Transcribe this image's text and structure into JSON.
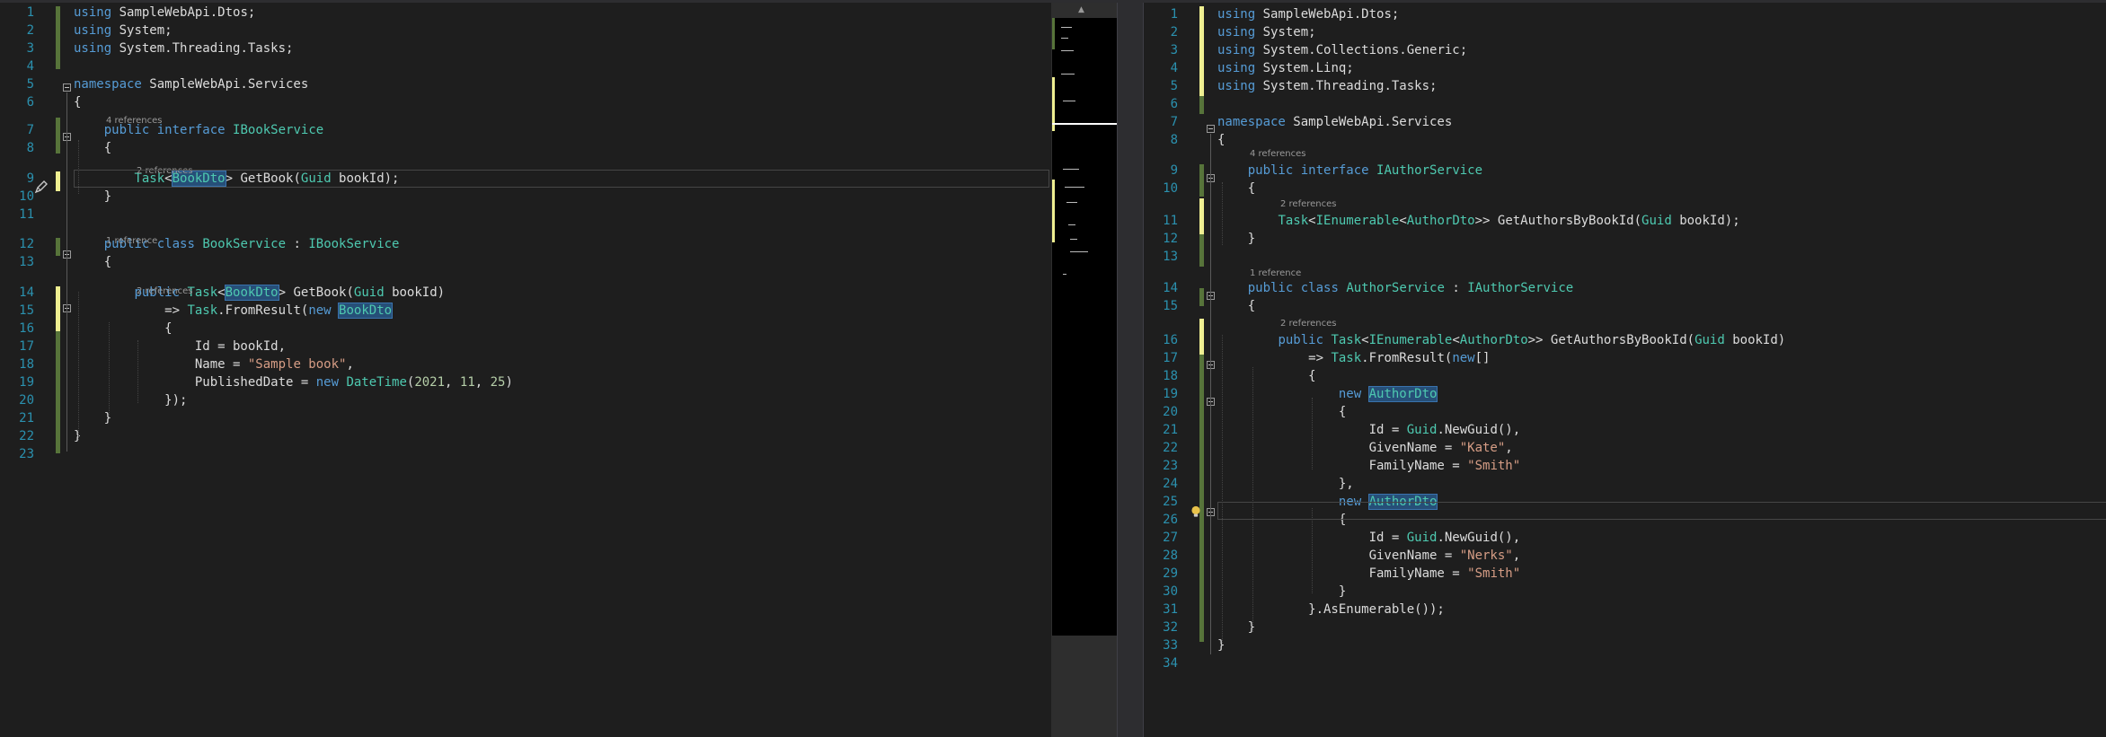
{
  "left_editor": {
    "references": {
      "r1": "4 references",
      "r2": "2 references",
      "r3": "1 reference",
      "r4": "2 references"
    },
    "lines": [
      [
        "1",
        [
          [
            "kw",
            "using"
          ],
          [
            "t",
            " SampleWebApi.Dtos;"
          ]
        ]
      ],
      [
        "2",
        [
          [
            "kw",
            "using"
          ],
          [
            "t",
            " System;"
          ]
        ]
      ],
      [
        "3",
        [
          [
            "kw",
            "using"
          ],
          [
            "t",
            " System.Threading.Tasks;"
          ]
        ]
      ],
      [
        "4",
        []
      ],
      [
        "5",
        [
          [
            "kw",
            "namespace"
          ],
          [
            "t",
            " SampleWebApi.Services"
          ]
        ]
      ],
      [
        "6",
        [
          [
            "t",
            "{"
          ]
        ]
      ],
      [
        "7",
        [
          [
            "t",
            "    "
          ],
          [
            "kw",
            "public"
          ],
          [
            "t",
            " "
          ],
          [
            "kw",
            "interface"
          ],
          [
            "t",
            " "
          ],
          [
            "ty",
            "IBookService"
          ]
        ]
      ],
      [
        "8",
        [
          [
            "t",
            "    {"
          ]
        ]
      ],
      [
        "9",
        [
          [
            "t",
            "        "
          ],
          [
            "ty",
            "Task"
          ],
          [
            "t",
            "<"
          ],
          [
            "hlty",
            "BookDto"
          ],
          [
            "t",
            "> GetBook("
          ],
          [
            "ty",
            "Guid"
          ],
          [
            "t",
            " bookId);"
          ]
        ]
      ],
      [
        "10",
        [
          [
            "t",
            "    }"
          ]
        ]
      ],
      [
        "11",
        []
      ],
      [
        "12",
        [
          [
            "t",
            "    "
          ],
          [
            "kw",
            "public"
          ],
          [
            "t",
            " "
          ],
          [
            "kw",
            "class"
          ],
          [
            "t",
            " "
          ],
          [
            "ty",
            "BookService"
          ],
          [
            "t",
            " : "
          ],
          [
            "ty",
            "IBookService"
          ]
        ]
      ],
      [
        "13",
        [
          [
            "t",
            "    {"
          ]
        ]
      ],
      [
        "14",
        [
          [
            "t",
            "        "
          ],
          [
            "kw",
            "public"
          ],
          [
            "t",
            " "
          ],
          [
            "ty",
            "Task"
          ],
          [
            "t",
            "<"
          ],
          [
            "hlty",
            "BookDto"
          ],
          [
            "t",
            "> GetBook("
          ],
          [
            "ty",
            "Guid"
          ],
          [
            "t",
            " bookId)"
          ]
        ]
      ],
      [
        "15",
        [
          [
            "t",
            "            => "
          ],
          [
            "ty",
            "Task"
          ],
          [
            "t",
            ".FromResult("
          ],
          [
            "kw",
            "new"
          ],
          [
            "t",
            " "
          ],
          [
            "hlty",
            "BookDto"
          ]
        ]
      ],
      [
        "16",
        [
          [
            "t",
            "            {"
          ]
        ]
      ],
      [
        "17",
        [
          [
            "t",
            "                Id = bookId,"
          ]
        ]
      ],
      [
        "18",
        [
          [
            "t",
            "                Name = "
          ],
          [
            "st",
            "\"Sample book\""
          ],
          [
            "t",
            ","
          ]
        ]
      ],
      [
        "19",
        [
          [
            "t",
            "                PublishedDate = "
          ],
          [
            "kw",
            "new"
          ],
          [
            "t",
            " "
          ],
          [
            "ty",
            "DateTime"
          ],
          [
            "t",
            "("
          ],
          [
            "nm",
            "2021"
          ],
          [
            "t",
            ", "
          ],
          [
            "nm",
            "11"
          ],
          [
            "t",
            ", "
          ],
          [
            "nm",
            "25"
          ],
          [
            "t",
            ")"
          ]
        ]
      ],
      [
        "20",
        [
          [
            "t",
            "            });"
          ]
        ]
      ],
      [
        "21",
        [
          [
            "t",
            "    }"
          ]
        ]
      ],
      [
        "22",
        [
          [
            "t",
            "}"
          ]
        ]
      ],
      [
        "23",
        []
      ]
    ]
  },
  "right_editor": {
    "references": {
      "r1": "4 references",
      "r2": "2 references",
      "r3": "1 reference",
      "r4": "2 references"
    },
    "lines": [
      [
        "1",
        [
          [
            "kw",
            "using"
          ],
          [
            "t",
            " SampleWebApi.Dtos;"
          ]
        ]
      ],
      [
        "2",
        [
          [
            "kw",
            "using"
          ],
          [
            "t",
            " System;"
          ]
        ]
      ],
      [
        "3",
        [
          [
            "kw",
            "using"
          ],
          [
            "t",
            " System.Collections.Generic;"
          ]
        ]
      ],
      [
        "4",
        [
          [
            "kw",
            "using"
          ],
          [
            "t",
            " System.Linq;"
          ]
        ]
      ],
      [
        "5",
        [
          [
            "kw",
            "using"
          ],
          [
            "t",
            " System.Threading.Tasks;"
          ]
        ]
      ],
      [
        "6",
        []
      ],
      [
        "7",
        [
          [
            "kw",
            "namespace"
          ],
          [
            "t",
            " SampleWebApi.Services"
          ]
        ]
      ],
      [
        "8",
        [
          [
            "t",
            "{"
          ]
        ]
      ],
      [
        "9",
        [
          [
            "t",
            "    "
          ],
          [
            "kw",
            "public"
          ],
          [
            "t",
            " "
          ],
          [
            "kw",
            "interface"
          ],
          [
            "t",
            " "
          ],
          [
            "ty",
            "IAuthorService"
          ]
        ]
      ],
      [
        "10",
        [
          [
            "t",
            "    {"
          ]
        ]
      ],
      [
        "11",
        [
          [
            "t",
            "        "
          ],
          [
            "ty",
            "Task"
          ],
          [
            "t",
            "<"
          ],
          [
            "ty",
            "IEnumerable"
          ],
          [
            "t",
            "<"
          ],
          [
            "ty",
            "AuthorDto"
          ],
          [
            "t",
            ">> GetAuthorsByBookId("
          ],
          [
            "ty",
            "Guid"
          ],
          [
            "t",
            " bookId);"
          ]
        ]
      ],
      [
        "12",
        [
          [
            "t",
            "    }"
          ]
        ]
      ],
      [
        "13",
        []
      ],
      [
        "14",
        [
          [
            "t",
            "    "
          ],
          [
            "kw",
            "public"
          ],
          [
            "t",
            " "
          ],
          [
            "kw",
            "class"
          ],
          [
            "t",
            " "
          ],
          [
            "ty",
            "AuthorService"
          ],
          [
            "t",
            " : "
          ],
          [
            "ty",
            "IAuthorService"
          ]
        ]
      ],
      [
        "15",
        [
          [
            "t",
            "    {"
          ]
        ]
      ],
      [
        "16",
        [
          [
            "t",
            "        "
          ],
          [
            "kw",
            "public"
          ],
          [
            "t",
            " "
          ],
          [
            "ty",
            "Task"
          ],
          [
            "t",
            "<"
          ],
          [
            "ty",
            "IEnumerable"
          ],
          [
            "t",
            "<"
          ],
          [
            "ty",
            "AuthorDto"
          ],
          [
            "t",
            ">> GetAuthorsByBookId("
          ],
          [
            "ty",
            "Guid"
          ],
          [
            "t",
            " bookId)"
          ]
        ]
      ],
      [
        "17",
        [
          [
            "t",
            "            => "
          ],
          [
            "ty",
            "Task"
          ],
          [
            "t",
            ".FromResult("
          ],
          [
            "kw",
            "new"
          ],
          [
            "t",
            "[]"
          ]
        ]
      ],
      [
        "18",
        [
          [
            "t",
            "            {"
          ]
        ]
      ],
      [
        "19",
        [
          [
            "t",
            "                "
          ],
          [
            "kw",
            "new"
          ],
          [
            "t",
            " "
          ],
          [
            "hlty",
            "AuthorDto"
          ]
        ]
      ],
      [
        "20",
        [
          [
            "t",
            "                {"
          ]
        ]
      ],
      [
        "21",
        [
          [
            "t",
            "                    Id = "
          ],
          [
            "ty",
            "Guid"
          ],
          [
            "t",
            ".NewGuid(),"
          ]
        ]
      ],
      [
        "22",
        [
          [
            "t",
            "                    GivenName = "
          ],
          [
            "st",
            "\"Kate\""
          ],
          [
            "t",
            ","
          ]
        ]
      ],
      [
        "23",
        [
          [
            "t",
            "                    FamilyName = "
          ],
          [
            "st",
            "\"Smith\""
          ]
        ]
      ],
      [
        "24",
        [
          [
            "t",
            "                },"
          ]
        ]
      ],
      [
        "25",
        [
          [
            "t",
            "                "
          ],
          [
            "kw",
            "new"
          ],
          [
            "t",
            " "
          ],
          [
            "hlty",
            "AuthorDto"
          ]
        ]
      ],
      [
        "26",
        [
          [
            "t",
            "                {"
          ]
        ]
      ],
      [
        "27",
        [
          [
            "t",
            "                    Id = "
          ],
          [
            "ty",
            "Guid"
          ],
          [
            "t",
            ".NewGuid(),"
          ]
        ]
      ],
      [
        "28",
        [
          [
            "t",
            "                    GivenName = "
          ],
          [
            "st",
            "\"Nerks\""
          ],
          [
            "t",
            ","
          ]
        ]
      ],
      [
        "29",
        [
          [
            "t",
            "                    FamilyName = "
          ],
          [
            "st",
            "\"Smith\""
          ]
        ]
      ],
      [
        "30",
        [
          [
            "t",
            "                }"
          ]
        ]
      ],
      [
        "31",
        [
          [
            "t",
            "            }.AsEnumerable());"
          ]
        ]
      ],
      [
        "32",
        [
          [
            "t",
            "    }"
          ]
        ]
      ],
      [
        "33",
        [
          [
            "t",
            "}"
          ]
        ]
      ],
      [
        "34",
        []
      ]
    ]
  },
  "colors": {
    "background": "#1e1e1e",
    "keyword": "#569cd6",
    "type": "#4ec9b0",
    "string": "#d69d85",
    "number": "#b5cea8",
    "line_number": "#2b91af",
    "saved_change": "#57743a",
    "unsaved_change": "#efef91"
  },
  "icons": {
    "left_line9": "quick-action-pencil-icon",
    "right_line25": "lightbulb-icon",
    "minimap_up": "scroll-up-arrow-icon"
  }
}
